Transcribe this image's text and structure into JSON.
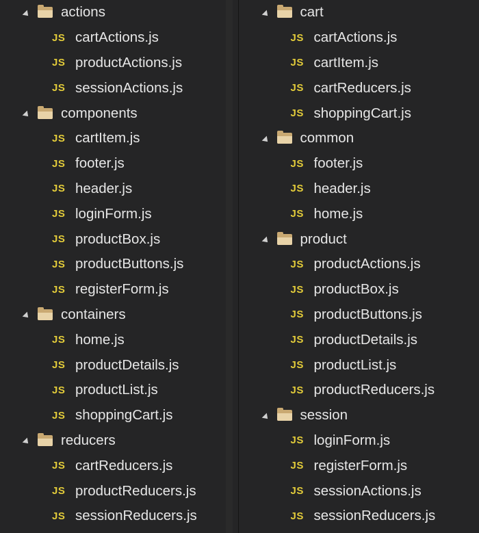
{
  "explorer_left": {
    "folders": [
      {
        "name": "actions",
        "files": [
          "cartActions.js",
          "productActions.js",
          "sessionActions.js"
        ]
      },
      {
        "name": "components",
        "files": [
          "cartItem.js",
          "footer.js",
          "header.js",
          "loginForm.js",
          "productBox.js",
          "productButtons.js",
          "registerForm.js"
        ]
      },
      {
        "name": "containers",
        "files": [
          "home.js",
          "productDetails.js",
          "productList.js",
          "shoppingCart.js"
        ]
      },
      {
        "name": "reducers",
        "files": [
          "cartReducers.js",
          "productReducers.js",
          "sessionReducers.js"
        ]
      }
    ]
  },
  "explorer_right": {
    "folders": [
      {
        "name": "cart",
        "files": [
          "cartActions.js",
          "cartItem.js",
          "cartReducers.js",
          "shoppingCart.js"
        ]
      },
      {
        "name": "common",
        "files": [
          "footer.js",
          "header.js",
          "home.js"
        ]
      },
      {
        "name": "product",
        "files": [
          "productActions.js",
          "productBox.js",
          "productButtons.js",
          "productDetails.js",
          "productList.js",
          "productReducers.js"
        ]
      },
      {
        "name": "session",
        "files": [
          "loginForm.js",
          "registerForm.js",
          "sessionActions.js",
          "sessionReducers.js"
        ]
      }
    ]
  },
  "file_icon_label": "JS",
  "colors": {
    "background": "#252526",
    "text": "#e6e6e6",
    "js_icon": "#e3cc3a",
    "folder_icon": "#e8d3a8"
  }
}
